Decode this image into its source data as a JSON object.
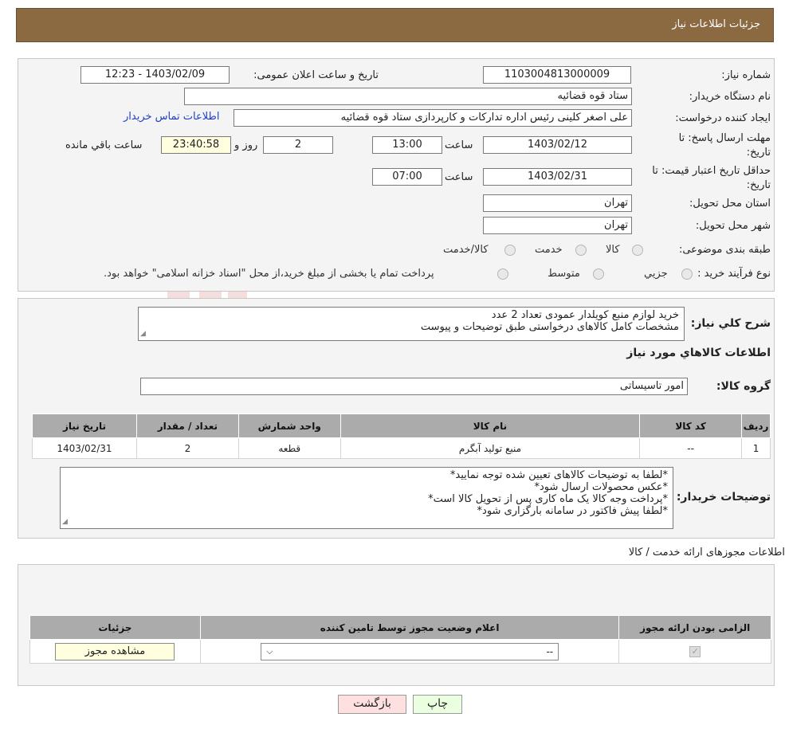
{
  "header": {
    "title": "جزئیات اطلاعات نیاز"
  },
  "watermark": {
    "text": "AriaTender.neT"
  },
  "info": {
    "need_number_label": "شماره نیاز:",
    "need_number": "1103004813000009",
    "announce_label": "تاریخ و ساعت اعلان عمومی:",
    "announce_value": "1403/02/09 - 12:23",
    "buyer_org_label": "نام دستگاه خریدار:",
    "buyer_org": "ستاد قوه قضائیه",
    "creator_label": "ایجاد کننده درخواست:",
    "creator": "علی اصغر کلینی رئیس اداره تدارکات و کارپردازی ستاد قوه قضائیه",
    "contact_link": "اطلاعات تماس خریدار",
    "deadline_label_1": "مهلت ارسال پاسخ: تا",
    "deadline_label_2": "تاریخ:",
    "deadline_date": "1403/02/12",
    "time_label": "ساعت",
    "deadline_time": "13:00",
    "days_value": "2",
    "days_label": "روز و",
    "remaining_time": "23:40:58",
    "remaining_label": "ساعت باقي مانده",
    "validity_label_1": "حداقل تاریخ اعتبار قیمت: تا",
    "validity_label_2": "تاریخ:",
    "validity_date": "1403/02/31",
    "validity_time": "07:00",
    "province_label": "استان محل تحویل:",
    "province": "تهران",
    "city_label": "شهر محل تحویل:",
    "city": "تهران",
    "category_label": "طبقه بندی موضوعی:",
    "category_options": [
      "کالا",
      "خدمت",
      "کالا/خدمت"
    ],
    "process_label": "نوع فرآیند خرید :",
    "process_options": [
      "جزیي",
      "متوسط"
    ],
    "process_note": "پرداخت تمام یا بخشی از مبلغ خرید،از محل \"اسناد خزانه اسلامی\" خواهد بود."
  },
  "details": {
    "summary_label": "شرح کلي نياز:",
    "summary_lines": [
      "خرید لوازم منبع کویلدار عمودی تعداد 2 عدد",
      "مشخصات کامل کالاهای درخواستی طبق توضیحات و پیوست"
    ],
    "goods_title": "اطلاعات کالاهاي مورد نياز",
    "goods_group_label": "گروه کالا:",
    "goods_group": "امور تاسیساتی",
    "table": {
      "headers": [
        "رديف",
        "کد کالا",
        "نام کالا",
        "واحد شمارش",
        "تعداد / مقدار",
        "تاریخ نیاز"
      ],
      "rows": [
        [
          "1",
          "--",
          "منبع تولید آبگرم",
          "قطعه",
          "2",
          "1403/02/31"
        ]
      ]
    },
    "buyer_notes_label": "توضیحات خریدار:",
    "buyer_notes_lines": [
      "*لطفا به توضیحات کالاهای تعیین شده توجه نمایید*",
      "*عکس محصولات ارسال شود*",
      "*پرداخت وجه کالا یک ماه کاری پس از تحویل کالا است*",
      "*لطفا پیش فاکتور در سامانه بارگزاری شود*"
    ]
  },
  "permits": {
    "title": "اطلاعات مجوزهای ارائه خدمت / کالا",
    "headers": [
      "الزامی بودن ارائه مجوز",
      "اعلام وضعیت مجوز توسط تامین کننده",
      "جزئیات"
    ],
    "select_value": "--",
    "view_button": "مشاهده مجوز"
  },
  "buttons": {
    "print": "چاپ",
    "back": "بازگشت"
  },
  "colors": {
    "header": "#8b6a42",
    "print_btn": "#eaffe0",
    "back_btn": "#ffe0e0",
    "table_header": "#ababab"
  }
}
